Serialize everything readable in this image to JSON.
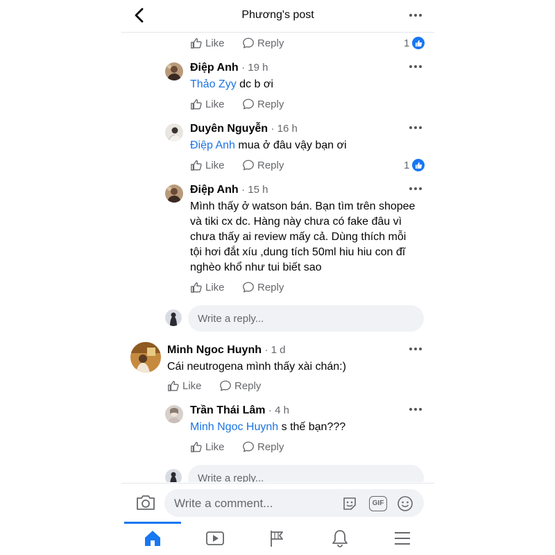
{
  "header": {
    "title": "Phương's post"
  },
  "top_actions": {
    "like": "Like",
    "reply": "Reply",
    "reaction_count": "1"
  },
  "comments": [
    {
      "name": "Điệp Anh",
      "time": "· 19 h",
      "mention": "Thảo Zyy",
      "text": " dc b ơi",
      "like": "Like",
      "reply": "Reply"
    },
    {
      "name": "Duyên Nguyễn",
      "time": "· 16 h",
      "mention": "Điệp Anh",
      "text": " mua ở đâu vậy bạn ơi",
      "like": "Like",
      "reply": "Reply",
      "reaction_count": "1"
    },
    {
      "name": "Điệp Anh",
      "time": "· 15 h",
      "lines": [
        "Mình thấy ở watson bán. Bạn tìm trên shopee",
        "và tiki cx dc. Hàng này chưa có fake đâu vì",
        "chưa thấy ai review mấy cả. Dùng thích mỗi",
        "tội hơi đắt xíu ,dung tích 50ml hiu hiu con đĩ",
        "nghèo khổ như tui biết sao"
      ],
      "like": "Like",
      "reply": "Reply"
    }
  ],
  "reply_box_1": {
    "placeholder": "Write a reply..."
  },
  "main_comment": {
    "name": "Minh Ngoc Huynh",
    "time": "· 1 d",
    "text": "Cái neutrogena mình thấy xài chán:)",
    "like": "Like",
    "reply": "Reply"
  },
  "nested_reply": {
    "name": "Trần Thái Lâm",
    "time": "· 4 h",
    "mention": "Minh Ngoc Huynh",
    "text": " s thế bạn???",
    "like": "Like",
    "reply": "Reply"
  },
  "reply_box_2": {
    "placeholder": "Write a reply..."
  },
  "composer": {
    "placeholder": "Write a comment...",
    "gif_label": "GIF"
  },
  "tabs": [
    "home-icon",
    "video-icon",
    "flag-icon",
    "bell-icon",
    "menu-icon"
  ],
  "colors": {
    "accent": "#1877f2",
    "mention": "#1b74e4",
    "muted": "#65676b",
    "input_bg": "#f0f2f5"
  }
}
